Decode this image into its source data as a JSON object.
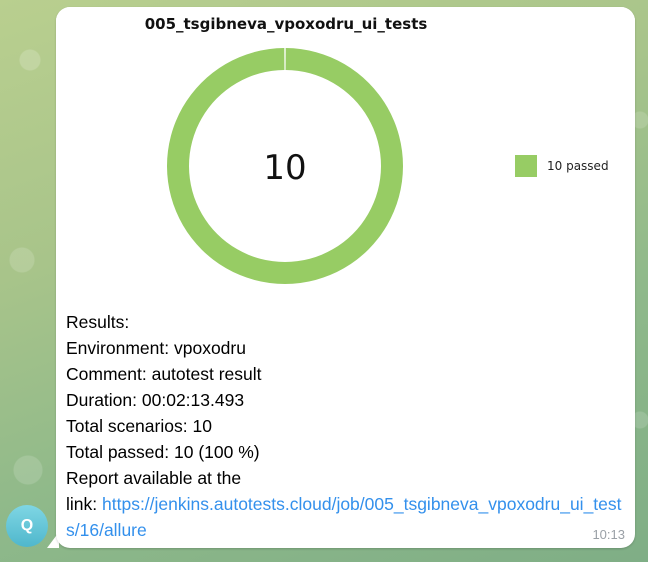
{
  "message": {
    "sender_initial": "Q",
    "timestamp": "10:13",
    "lines": {
      "results_label": "Results:",
      "environment_label": "Environment:",
      "environment_value": "vpoxodru",
      "comment_label": "Comment:",
      "comment_value": "autotest result",
      "duration_label": "Duration:",
      "duration_value": "00:02:13.493",
      "total_scenarios_label": "Total scenarios:",
      "total_scenarios_value": "10",
      "total_passed_label": "Total passed:",
      "total_passed_value": "10 (100 %)",
      "report_text_1": "Report available at the",
      "report_text_2": "link:",
      "report_link": "https://jenkins.autotests.cloud/job/005_tsgibneva_vpoxodru_ui_tests/16/allure"
    }
  },
  "chart_data": {
    "type": "pie",
    "title": "005_tsgibneva_vpoxodru_ui_tests",
    "center_label": "10",
    "donut": true,
    "series": [
      {
        "name": "passed",
        "value": 10,
        "color": "#97cc64"
      }
    ],
    "legend": [
      {
        "label": "10 passed",
        "color": "#97cc64"
      }
    ],
    "legend_placement": "right"
  }
}
